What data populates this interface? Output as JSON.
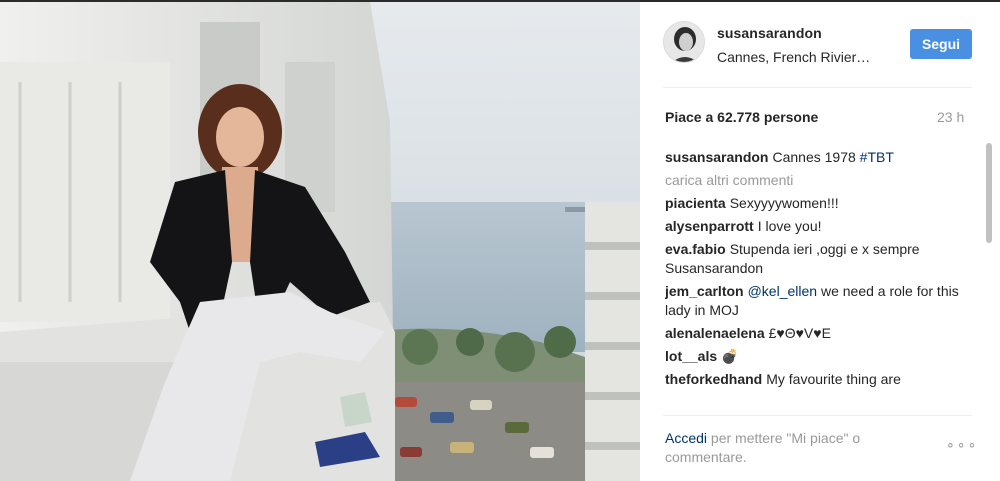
{
  "post": {
    "username": "susansarandon",
    "location": "Cannes, French Rivier…",
    "follow_label": "Segui",
    "likes": "Piace a 62.778 persone",
    "time": "23 h"
  },
  "caption": {
    "user": "susansarandon",
    "text": "Cannes 1978 ",
    "tag": "#TBT"
  },
  "load_more": "carica altri commenti",
  "comments": [
    {
      "user": "piacienta",
      "text": "Sexyyyywomen!!!"
    },
    {
      "user": "alysenparrott",
      "text": "I love you!"
    },
    {
      "user": "eva.fabio",
      "text": "Stupenda ieri ,oggi e x sempre Susansarandon"
    },
    {
      "user": "jem_carlton",
      "mention": "@kel_ellen",
      "text": " we need a role for this lady in MOJ"
    },
    {
      "user": "alenalenaelena",
      "text": "£♥Θ♥V♥E"
    },
    {
      "user": "lot__als",
      "text": "💣"
    },
    {
      "user": "theforkedhand",
      "text": "My favourite thing are"
    }
  ],
  "footer": {
    "login": "Accedi",
    "rest": " per mettere \"Mi piace\" o commentare.",
    "more": "∘∘∘"
  },
  "colors": {
    "follow_button": "#4a90e2",
    "link": "#003569",
    "muted": "#999999"
  }
}
